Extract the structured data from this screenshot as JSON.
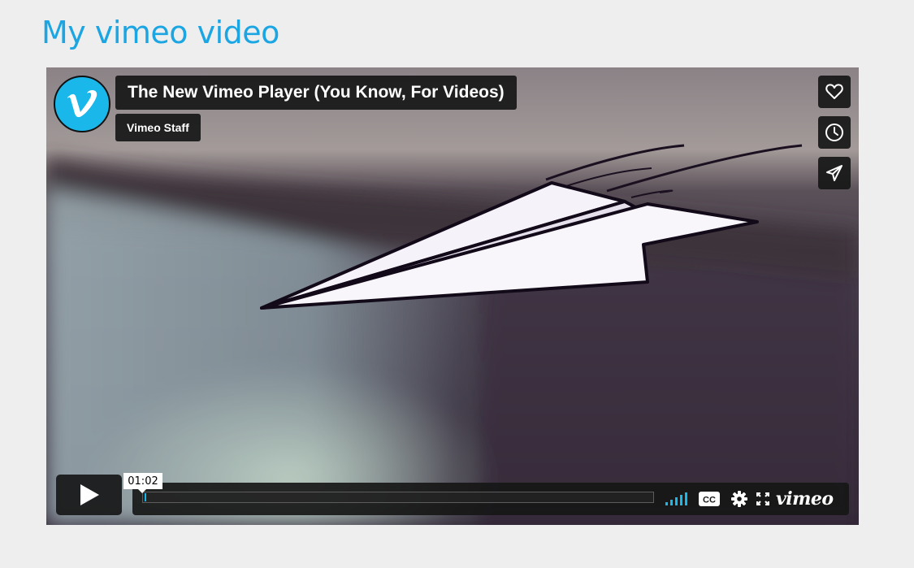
{
  "page": {
    "heading": "My vimeo video"
  },
  "player": {
    "video_title": "The New Vimeo Player (You Know, For Videos)",
    "byline": "Vimeo Staff",
    "current_time": "01:02",
    "progress_fraction": 0.002,
    "logo_text": "vimeo",
    "side_actions": [
      {
        "icon": "heart-icon"
      },
      {
        "icon": "clock-icon"
      },
      {
        "icon": "paper-plane-icon"
      }
    ],
    "controls": [
      "play-icon",
      "volume-bars-icon",
      "cc-icon",
      "gear-icon",
      "fullscreen-icon"
    ]
  },
  "colors": {
    "accent": "#1ab7ea",
    "heading": "#1ba6e3",
    "page_background": "#eeeeee",
    "control_background": "#171717"
  }
}
